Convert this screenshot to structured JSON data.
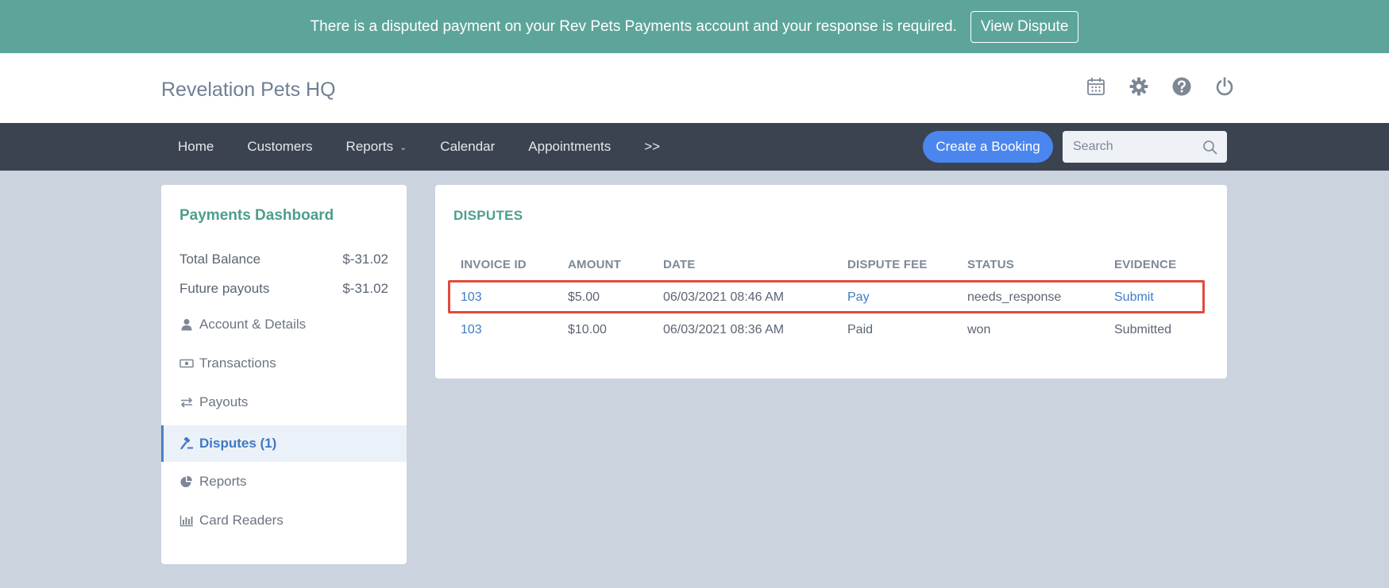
{
  "banner": {
    "message": "There is a disputed payment on your Rev Pets Payments account and your response is required.",
    "button_label": "View Dispute",
    "bg_color": "#5da59a"
  },
  "header": {
    "brand": "Revelation Pets HQ",
    "icons": [
      "calendar-icon",
      "gear-icon",
      "help-icon",
      "power-icon"
    ]
  },
  "nav": {
    "items": [
      {
        "label": "Home"
      },
      {
        "label": "Customers"
      },
      {
        "label": "Reports",
        "dropdown": true
      },
      {
        "label": "Calendar"
      },
      {
        "label": "Appointments"
      },
      {
        "label": ">>"
      }
    ],
    "book_label": "Create a Booking",
    "search_placeholder": "Search",
    "accent": "#4b86ee"
  },
  "sidebar": {
    "title": "Payments Dashboard",
    "balances": [
      {
        "label": "Total Balance",
        "value": "$-31.02"
      },
      {
        "label": "Future payouts",
        "value": "$-31.02"
      }
    ],
    "items": [
      {
        "label": "Account & Details",
        "icon": "user-icon",
        "active": false
      },
      {
        "label": "Transactions",
        "icon": "cash-icon",
        "active": false
      },
      {
        "label": "Payouts",
        "icon": "exchange-icon",
        "active": false
      },
      {
        "label": "Disputes (1)",
        "icon": "gavel-icon",
        "active": true
      },
      {
        "label": "Reports",
        "icon": "pie-chart-icon",
        "active": false
      },
      {
        "label": "Card Readers",
        "icon": "bar-chart-icon",
        "active": false
      }
    ]
  },
  "disputes": {
    "title": "DISPUTES",
    "columns": [
      "INVOICE ID",
      "AMOUNT",
      "DATE",
      "DISPUTE FEE",
      "STATUS",
      "EVIDENCE"
    ],
    "rows": [
      {
        "invoice": "103",
        "amount": "$5.00",
        "date": "06/03/2021 08:46 AM",
        "fee": "Pay",
        "status": "needs_response",
        "evidence": "Submit"
      },
      {
        "invoice": "103",
        "amount": "$10.00",
        "date": "06/03/2021 08:36 AM",
        "fee": "Paid",
        "status": "won",
        "evidence": "Submitted"
      }
    ],
    "highlight_color": "#e24a3b"
  }
}
